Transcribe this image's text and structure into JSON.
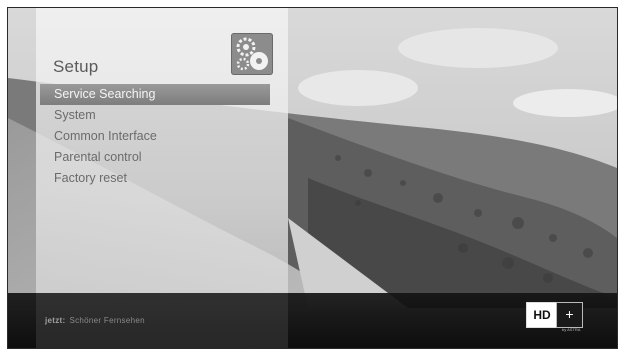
{
  "menu": {
    "title": "Setup",
    "icon": "setup-gears-icon",
    "selected_index": 0,
    "items": [
      {
        "label": "Service Searching"
      },
      {
        "label": "System"
      },
      {
        "label": "Common Interface"
      },
      {
        "label": "Parental control"
      },
      {
        "label": "Factory reset"
      }
    ]
  },
  "channel_bar": {
    "label": "jetzt:",
    "program": "Schöner Fernsehen"
  },
  "logo": {
    "hd": "HD",
    "plus": "+",
    "sub": "by ASTRA"
  },
  "colors": {
    "selection": "#8a8a8a",
    "menu_text": "#6b6b6b",
    "bar": "#0c0c0c"
  }
}
